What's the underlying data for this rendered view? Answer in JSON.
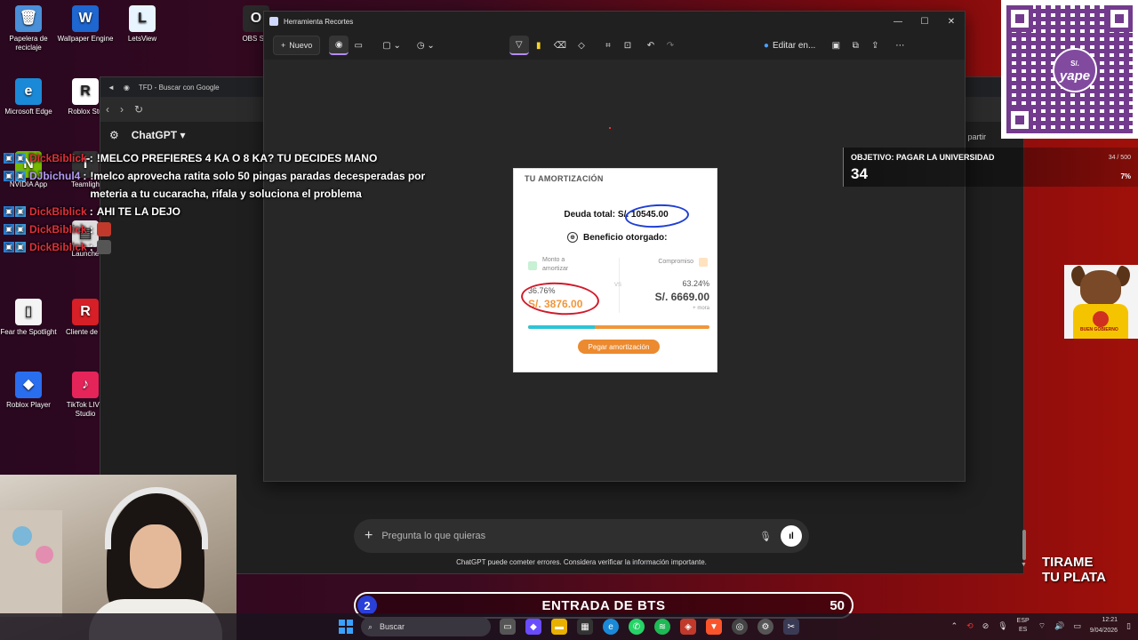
{
  "desktop_icons": [
    {
      "label": "Papelera de reciclaje",
      "glyph": "🗑",
      "color": "#4a90d9"
    },
    {
      "label": "Wallpaper Engine",
      "glyph": "W",
      "color": "#1e66d0"
    },
    {
      "label": "LetsView",
      "glyph": "L",
      "color": "#e8f4ff"
    },
    {
      "label": "OBS Stu",
      "glyph": "O",
      "color": "#2a2a2a"
    },
    {
      "label": "Microsoft Edge",
      "glyph": "e",
      "color": "#1a8ad8"
    },
    {
      "label": "Roblox Stu",
      "glyph": "R",
      "color": "#ffffff"
    },
    {
      "label": "NVIDIA App",
      "glyph": "N",
      "color": "#76b900"
    },
    {
      "label": "Teamligh",
      "glyph": "T",
      "color": "#333"
    },
    {
      "label": "Launche",
      "glyph": "▤",
      "color": "#ddd"
    },
    {
      "label": "Fear the Spotlight",
      "glyph": "▯",
      "color": "#f4f4f4"
    },
    {
      "label": "Cliente de R",
      "glyph": "R",
      "color": "#d61f26"
    },
    {
      "label": "Roblox Player",
      "glyph": "◆",
      "color": "#2a6ef0"
    },
    {
      "label": "TikTok LIVE Studio",
      "glyph": "♪",
      "color": "#e5245a"
    }
  ],
  "browser": {
    "tab_title": "TFD - Buscar con Google",
    "chatgpt_label": "ChatGPT",
    "share_label": "partir",
    "input_placeholder": "Pregunta lo que quieras",
    "disclaimer": "ChatGPT puede cometer errores. Considera verificar la información importante."
  },
  "snip": {
    "title": "Herramienta Recortes",
    "new_label": "Nuevo",
    "edit_label": "Editar en..."
  },
  "card": {
    "title": "TU AMORTIZACIÓN",
    "debt_label": "Deuda total: S/.",
    "debt_amount": "10545.00",
    "benefit_label": "Beneficio otorgado:",
    "left_label_1": "Monto a",
    "left_label_2": "amortizar",
    "vs": "VS",
    "right_label": "Compromiso",
    "left_pct": "36.76%",
    "left_amount": "S/. 3876.00",
    "right_pct": "63.24%",
    "right_amount": "S/. 6669.00",
    "mora": "+ mora",
    "progress_fraction": 0.3676,
    "pay_button": "Pegar amortización"
  },
  "chat": [
    {
      "user": "DickBiblick",
      "color": "red",
      "sep": ":",
      "msg": "!MELCO PREFIERES 4 KA O 8 KA? TU DECIDES MANO"
    },
    {
      "user": "DJbichul4",
      "color": "purple",
      "sep": ":",
      "msg": "!melco aprovecha ratita solo 50 pingas paradas decesperadas por meteria a tu cucaracha, rifala y soluciona el problema"
    },
    {
      "user": "DickBiblick",
      "color": "red",
      "sep": ":",
      "msg": "AHI TE LA DEJO"
    },
    {
      "user": "DickBiblick",
      "color": "red",
      "sep": ":",
      "msg": "",
      "emote": "#c0392b"
    },
    {
      "user": "DickBiblick",
      "color": "red",
      "sep": ":",
      "msg": "",
      "emote": "#555"
    }
  ],
  "qr": {
    "brand": "yape",
    "currency": "S/."
  },
  "goal": {
    "title": "OBJETIVO: PAGAR LA UNIVERSIDAD",
    "value": "34",
    "count": "34 / 500",
    "percent": "7%"
  },
  "dog_sign": "BUEN GOBIERNO",
  "tirame": {
    "line1": "TIRAME",
    "line2": "TU PLATA"
  },
  "bts": {
    "left": "2",
    "label": "ENTRADA DE BTS",
    "right": "50"
  },
  "taskbar": {
    "search": "Buscar",
    "lang_1": "ESP",
    "lang_2": "ES",
    "time": "12:21",
    "date": "9/04/2026"
  }
}
